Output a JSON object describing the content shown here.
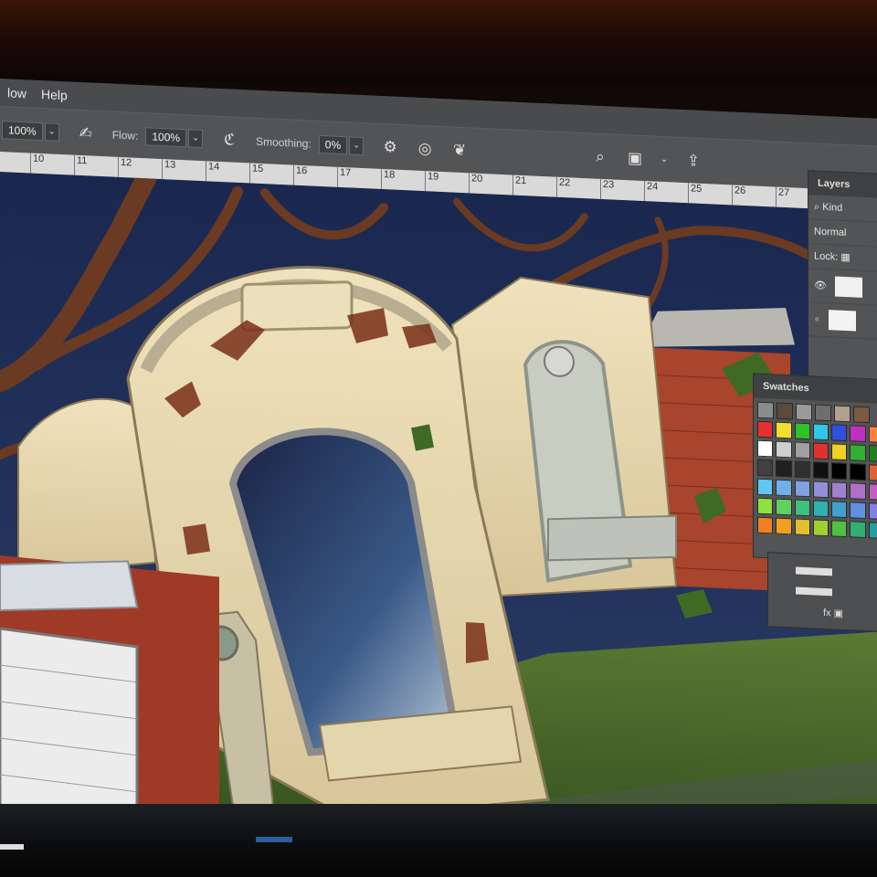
{
  "menubar": {
    "items": [
      "low",
      "Help"
    ]
  },
  "options": {
    "opacity_value": "100%",
    "flow_label": "Flow:",
    "flow_value": "100%",
    "smoothing_label": "Smoothing:",
    "smoothing_value": "0%"
  },
  "ruler": {
    "ticks": [
      "10",
      "11",
      "12",
      "13",
      "14",
      "15",
      "16",
      "17",
      "18",
      "19",
      "20",
      "21",
      "22",
      "23",
      "24",
      "25",
      "26",
      "27"
    ]
  },
  "layers_panel": {
    "tab": "Layers",
    "filter": "Kind",
    "blend_mode": "Normal",
    "lock_label": "Lock:"
  },
  "swatches_panel": {
    "tab": "Swatches",
    "recent": [
      "#8c8c8c",
      "#5a4a3a",
      "#9a9a9a",
      "#6e6e6e",
      "#b0a090",
      "#7a5a40"
    ],
    "rows": [
      [
        "#e53030",
        "#f2e030",
        "#30c030",
        "#30c8e8",
        "#3050e0",
        "#c030c0",
        "#ff8040"
      ],
      [
        "#ffffff",
        "#d0d0d0",
        "#a0a0a0",
        "#e03030",
        "#f0d020",
        "#30b030",
        "#208020"
      ],
      [
        "#404040",
        "#202020",
        "#303030",
        "#101010",
        "#000000",
        "#000000",
        "#e06030"
      ],
      [
        "#60c8f0",
        "#70b0e8",
        "#80a0e0",
        "#9090d8",
        "#a080d0",
        "#b070c8",
        "#c060c0"
      ],
      [
        "#90e040",
        "#60d060",
        "#40c080",
        "#30b0b0",
        "#40a0d0",
        "#6090e0",
        "#8080e8"
      ],
      [
        "#f08020",
        "#f0a020",
        "#e0c030",
        "#a0d030",
        "#50c040",
        "#30b070",
        "#20a0a0"
      ]
    ]
  },
  "colors": {
    "ui_dark": "#535456",
    "night_sky": "#1d2a4a",
    "stone": "#e6d9b0",
    "brick": "#a8452c",
    "grass": "#4a6a2a"
  }
}
